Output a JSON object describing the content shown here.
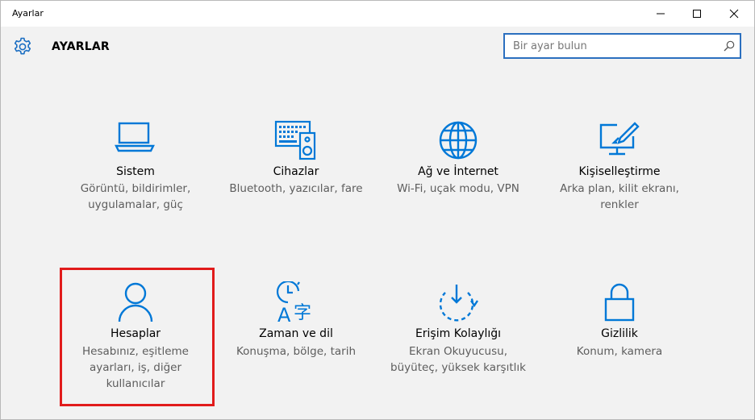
{
  "window": {
    "title": "Ayarlar",
    "controls": {
      "minimize": "minimize-icon",
      "maximize": "maximize-icon",
      "close": "close-icon"
    }
  },
  "header": {
    "title": "AYARLAR",
    "icon": "gear-icon",
    "search": {
      "placeholder": "Bir ayar bulun",
      "value": "",
      "icon": "search-icon"
    }
  },
  "accent_color": "#0078d7",
  "highlight_color": "#e11b1b",
  "tiles": [
    {
      "label": "Sistem",
      "description": "Görüntü, bildirimler, uygulamalar, güç",
      "icon": "laptop-icon"
    },
    {
      "label": "Cihazlar",
      "description": "Bluetooth, yazıcılar, fare",
      "icon": "devices-icon"
    },
    {
      "label": "Ağ ve İnternet",
      "description": "Wi-Fi, uçak modu, VPN",
      "icon": "globe-icon"
    },
    {
      "label": "Kişiselleştirme",
      "description": "Arka plan, kilit ekranı, renkler",
      "icon": "personalization-icon"
    },
    {
      "label": "Hesaplar",
      "description": "Hesabınız, eşitleme ayarları, iş, diğer kullanıcılar",
      "icon": "person-icon",
      "highlighted": true
    },
    {
      "label": "Zaman ve dil",
      "description": "Konuşma, bölge, tarih",
      "icon": "time-language-icon"
    },
    {
      "label": "Erişim Kolaylığı",
      "description": "Ekran Okuyucusu, büyüteç, yüksek karşıtlık",
      "icon": "ease-of-access-icon"
    },
    {
      "label": "Gizlilik",
      "description": "Konum, kamera",
      "icon": "lock-icon"
    }
  ]
}
